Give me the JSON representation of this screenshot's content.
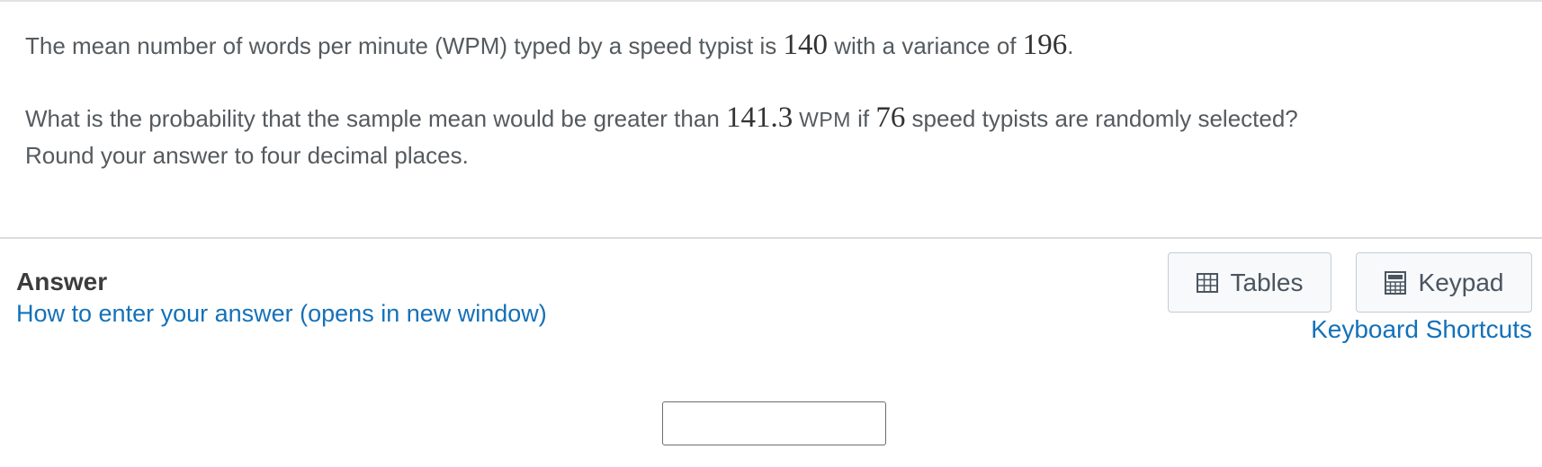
{
  "question": {
    "line1_a": "The mean number of words per minute (WPM) typed by a speed typist is ",
    "mean": "140",
    "line1_b": " with a variance of ",
    "variance": "196",
    "line1_c": ".",
    "line2_a": "What is the probability that the sample mean would be greater than ",
    "threshold": "141.3",
    "line2_unit": " WPM",
    "line2_b": " if ",
    "sample_size": "76",
    "line2_c": " speed typists are randomly selected?",
    "line3": "Round your answer to four decimal places."
  },
  "answer": {
    "heading": "Answer",
    "help_link": "How to enter your answer (opens in new window)",
    "input_value": ""
  },
  "tools": {
    "tables_label": "Tables",
    "tables_icon": "table-icon",
    "keypad_label": "Keypad",
    "keypad_icon": "calculator-icon",
    "shortcuts_label": "Keyboard Shortcuts"
  },
  "colors": {
    "link": "#1471b8",
    "text": "#555a5e",
    "button_border": "#c5ccd4"
  }
}
